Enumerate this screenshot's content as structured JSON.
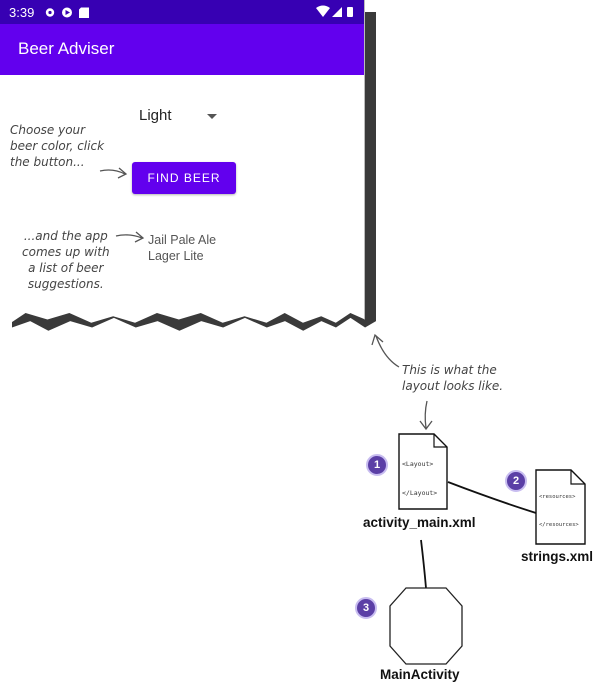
{
  "status_bar": {
    "time": "3:39"
  },
  "app": {
    "title": "Beer Adviser"
  },
  "spinner": {
    "selected": "Light"
  },
  "button": {
    "label": "FIND BEER"
  },
  "results": [
    "Jail Pale Ale",
    "Lager Lite"
  ],
  "annotations": {
    "choose": "Choose your\nbeer color, click\nthe button...",
    "app_comes_up": "...and the app\ncomes up with\na list of beer\nsuggestions.",
    "layout_note": "This is what the\nlayout looks like."
  },
  "files": {
    "layout": {
      "badge": "1",
      "name": "activity_main.xml",
      "open_tag": "<Layout>",
      "close_tag": "</Layout>"
    },
    "strings": {
      "badge": "2",
      "name": "strings.xml",
      "open_tag": "<resources>",
      "close_tag": "</resources>"
    },
    "activity": {
      "badge": "3",
      "name": "MainActivity"
    }
  },
  "colors": {
    "status_bar": "#3700b3",
    "app_bar": "#6200ee",
    "badge": "#5b3fa6"
  }
}
